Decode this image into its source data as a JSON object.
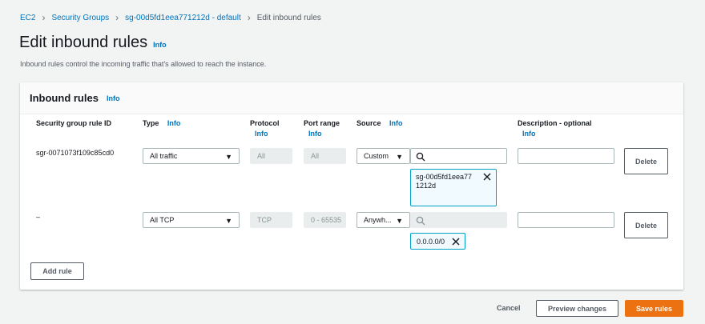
{
  "breadcrumb": {
    "items": [
      "EC2",
      "Security Groups",
      "sg-00d5fd1eea771212d - default",
      "Edit inbound rules"
    ],
    "separator": ">"
  },
  "page": {
    "title": "Edit inbound rules",
    "info": "Info",
    "subtitle": "Inbound rules control the incoming traffic that's allowed to reach the instance."
  },
  "panel": {
    "title": "Inbound rules",
    "info": "Info",
    "columns": {
      "rule_id": "Security group rule ID",
      "type": "Type",
      "type_info": "Info",
      "protocol": "Protocol",
      "protocol_info": "Info",
      "port_range": "Port range",
      "port_range_info": "Info",
      "source": "Source",
      "source_info": "Info",
      "description": "Description - optional",
      "description_info": "Info"
    },
    "rows": [
      {
        "rule_id": "sgr-0071073f109c85cd0",
        "type": "All traffic",
        "protocol": "All",
        "port_range": "All",
        "source_mode": "Custom",
        "search_value": "",
        "token": "sg-00d5fd1eea771212d",
        "delete_label": "Delete"
      },
      {
        "rule_id": "–",
        "type": "All TCP",
        "protocol": "TCP",
        "port_range": "0 - 65535",
        "source_mode": "Anywh...",
        "search_value": "",
        "token": "0.0.0.0/0",
        "delete_label": "Delete"
      }
    ],
    "add_rule": "Add rule"
  },
  "footer": {
    "cancel": "Cancel",
    "preview": "Preview changes",
    "save": "Save rules"
  },
  "colors": {
    "link": "#0073bb",
    "primary": "#ec7211",
    "token_border": "#00a1c9",
    "token_bg": "#f1faff"
  },
  "icons": [
    "chevron-right-icon",
    "caret-down-icon",
    "search-icon",
    "close-icon"
  ]
}
